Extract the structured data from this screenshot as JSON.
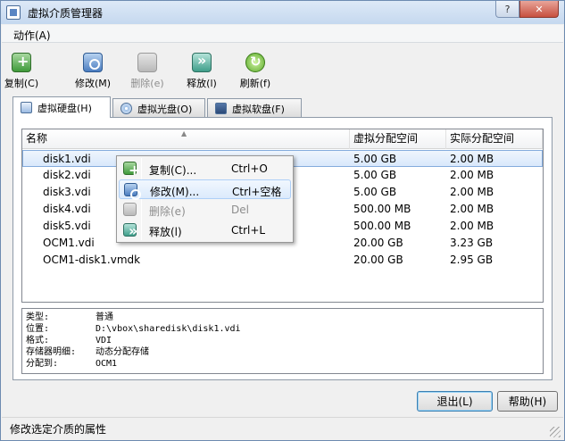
{
  "window": {
    "title": "虚拟介质管理器",
    "help_glyph": "?",
    "close_glyph": "✕"
  },
  "menu": {
    "actions": "动作(A)"
  },
  "toolbar": {
    "copy": "复制(C)",
    "modify": "修改(M)",
    "delete": "删除(e)",
    "release": "释放(l)",
    "refresh": "刷新(f)"
  },
  "tabs": [
    {
      "label": "虚拟硬盘(H)",
      "icon": "hard-disk-icon"
    },
    {
      "label": "虚拟光盘(O)",
      "icon": "optical-disc-icon"
    },
    {
      "label": "虚拟软盘(F)",
      "icon": "floppy-disk-icon"
    }
  ],
  "table": {
    "headers": {
      "name": "名称",
      "virtual_size": "虚拟分配空间",
      "actual_size": "实际分配空间"
    },
    "rows": [
      {
        "name": "disk1.vdi",
        "virtual_size": "5.00 GB",
        "actual_size": "2.00 MB"
      },
      {
        "name": "disk2.vdi",
        "virtual_size": "5.00 GB",
        "actual_size": "2.00 MB"
      },
      {
        "name": "disk3.vdi",
        "virtual_size": "5.00 GB",
        "actual_size": "2.00 MB"
      },
      {
        "name": "disk4.vdi",
        "virtual_size": "500.00 MB",
        "actual_size": "2.00 MB"
      },
      {
        "name": "disk5.vdi",
        "virtual_size": "500.00 MB",
        "actual_size": "2.00 MB"
      },
      {
        "name": "OCM1.vdi",
        "virtual_size": "20.00 GB",
        "actual_size": "3.23 GB"
      },
      {
        "name": "OCM1-disk1.vmdk",
        "virtual_size": "20.00 GB",
        "actual_size": "2.95 GB"
      }
    ]
  },
  "info": {
    "type_key": "类型:",
    "type_val": "普通",
    "location_key": "位置:",
    "location_val": "D:\\vbox\\sharedisk\\disk1.vdi",
    "format_key": "格式:",
    "format_val": "VDI",
    "storage_key": "存储器明细:",
    "storage_val": "动态分配存储",
    "attached_key": "分配到:",
    "attached_val": "OCM1"
  },
  "context_menu": {
    "copy": {
      "label": "复制(C)...",
      "shortcut": "Ctrl+O"
    },
    "modify": {
      "label": "修改(M)...",
      "shortcut": "Ctrl+空格"
    },
    "delete": {
      "label": "删除(e)",
      "shortcut": "Del"
    },
    "release": {
      "label": "释放(l)",
      "shortcut": "Ctrl+L"
    }
  },
  "buttons": {
    "exit": "退出(L)",
    "help": "帮助(H)"
  },
  "status": "修改选定介质的属性"
}
